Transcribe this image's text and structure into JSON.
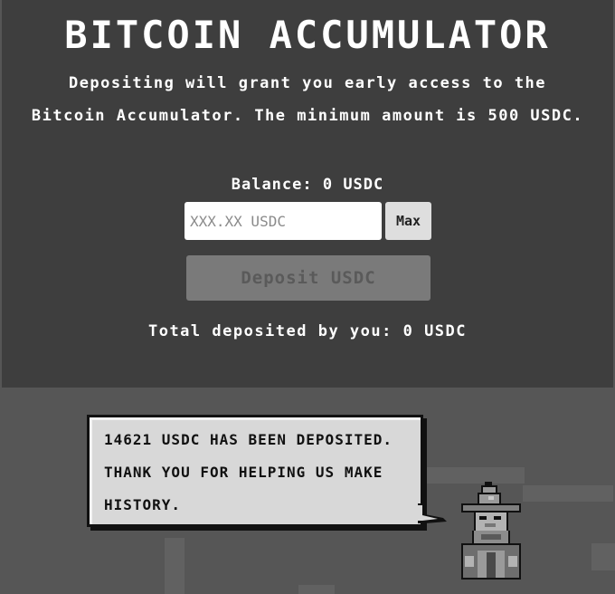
{
  "header": {
    "title": "BITCOIN ACCUMULATOR",
    "description_lines": [
      "Depositing will grant you early access to the",
      "Bitcoin Accumulator. The minimum amount is 500 USDC."
    ]
  },
  "deposit_form": {
    "balance_text": "Balance: 0 USDC",
    "amount_placeholder": "XXX.XX USDC",
    "amount_value": "",
    "max_label": "Max",
    "deposit_label": "Deposit USDC",
    "deposit_enabled": false,
    "total_text": "Total deposited by you: 0 USDC"
  },
  "speech_bubble": {
    "lines": [
      "14621 USDC HAS BEEN DEPOSITED.",
      "THANK YOU FOR HELPING US MAKE",
      "HISTORY."
    ]
  },
  "mascot": {
    "icon": "wizard-icon"
  },
  "colors": {
    "page_background": "#565656",
    "panel_background": "#3e3e3e",
    "text": "#ffffff",
    "button_disabled": "#7a7a7a",
    "bubble": "#d8d8d8"
  }
}
